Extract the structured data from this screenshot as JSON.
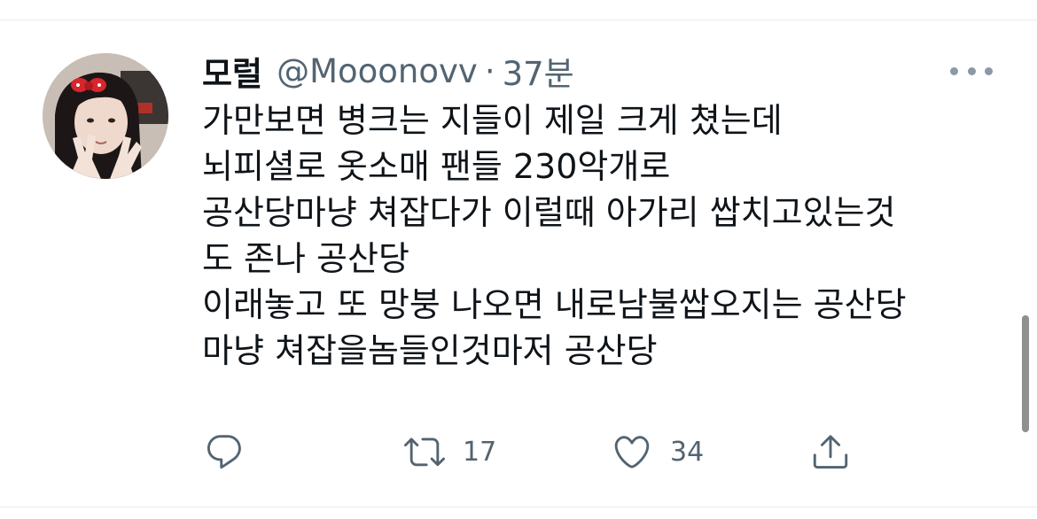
{
  "tweet": {
    "display_name": "모럴",
    "handle": "@Mooonovv",
    "separator": "·",
    "time": "37분",
    "lines": [
      "가만보면 병크는 지들이 제일 크게 쳤는데",
      "뇌피셜로 옷소매 팬들 230악개로",
      "공산당마냥 쳐잡다가 이럴때 아가리 쌉치고있는것",
      "도 존나 공산당",
      "이래놓고 또 망붕 나오면 내로남불쌉오지는 공산당",
      "마냥 쳐잡을놈들인것마저 공산당"
    ],
    "actions": {
      "reply_icon": "reply-icon",
      "retweet_icon": "retweet-icon",
      "retweet_count": "17",
      "like_icon": "heart-icon",
      "like_count": "34",
      "share_icon": "share-icon"
    }
  },
  "more_icon": "more-horizontal-icon",
  "colors": {
    "primary_text": "#0f1419",
    "secondary_text": "#536471",
    "divider": "#e6ecf0",
    "avatar_bow": "#d7262c"
  }
}
